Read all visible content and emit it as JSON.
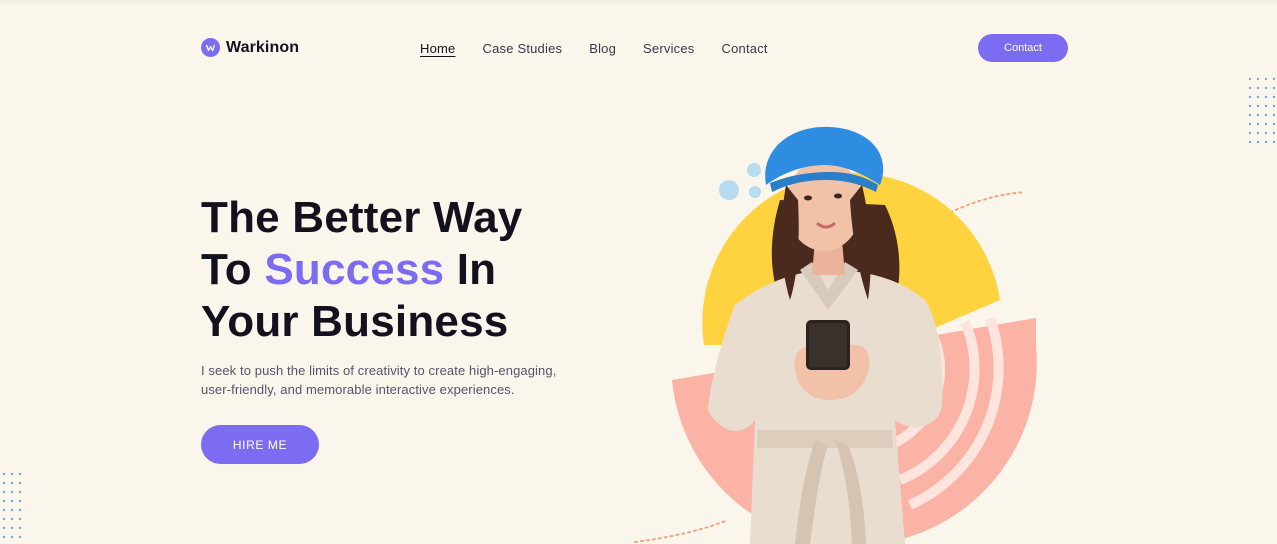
{
  "brand": {
    "name": "Warkinon",
    "accent": "#7c6cf2",
    "background": "#fbf6ec"
  },
  "nav": {
    "items": [
      {
        "label": "Home",
        "active": true
      },
      {
        "label": "Case Studies",
        "active": false
      },
      {
        "label": "Blog",
        "active": false
      },
      {
        "label": "Services",
        "active": false
      },
      {
        "label": "Contact",
        "active": false
      }
    ],
    "cta_label": "Contact"
  },
  "hero": {
    "line1": "The Better Way",
    "line2_before": "To ",
    "line2_accent": "Success",
    "line2_after": " In",
    "line3": "Your Business",
    "description": "I seek to push the limits of creativity to create high-engaging, user-friendly, and memorable interactive experiences.",
    "button_label": "HIRE ME"
  },
  "illustration": {
    "subject": "woman-in-blue-beret-holding-phone",
    "colors": {
      "yellow_arc": "#ffd23f",
      "pink_arc": "#fbb3a6",
      "bubbles": "#b7dcf0",
      "dotted_line": "#f3a37c",
      "dot_grid": "#6aa8e8"
    }
  }
}
